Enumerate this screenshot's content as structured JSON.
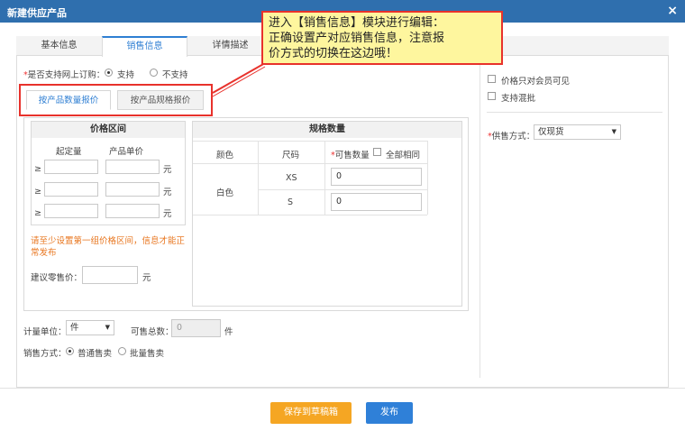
{
  "dialog": {
    "title": "新建供应产品",
    "close_glyph": "×"
  },
  "tabs": [
    {
      "label": "基本信息"
    },
    {
      "label": "销售信息"
    },
    {
      "label": "详情描述"
    }
  ],
  "online_order": {
    "label": "是否支持网上订购：",
    "required_mark": "*",
    "options": [
      {
        "label": "支持",
        "selected": true
      },
      {
        "label": "不支持",
        "selected": false
      }
    ]
  },
  "price_tabs": [
    {
      "label": "按产品数量报价"
    },
    {
      "label": "按产品规格报价"
    }
  ],
  "price_range": {
    "header": "价格区间",
    "col_min": "起定量",
    "col_price": "产品单价",
    "ge": "≥",
    "unit": "元",
    "rows": [
      {
        "min": "",
        "price": ""
      },
      {
        "min": "",
        "price": ""
      },
      {
        "min": "",
        "price": ""
      }
    ],
    "warning": "请至少设置第一组价格区间，信息才能正常发布",
    "suggest_label": "建议零售价：",
    "suggest_value": "",
    "suggest_unit": "元"
  },
  "spec": {
    "header": "规格数量",
    "col_color": "颜色",
    "col_size": "尺码",
    "col_qty": "可售数量",
    "required_mark": "*",
    "all_same": "全部相同",
    "color": "白色",
    "rows": [
      {
        "size": "XS",
        "qty": "0"
      },
      {
        "size": "S",
        "qty": "0"
      }
    ]
  },
  "unit": {
    "label": "计量单位：",
    "value": "件"
  },
  "total": {
    "label": "可售总数：",
    "value": "0",
    "unit": "件"
  },
  "sale_mode": {
    "label": "销售方式：",
    "options": [
      {
        "label": "普通售卖",
        "selected": true
      },
      {
        "label": "批量售卖",
        "selected": false
      }
    ]
  },
  "right_panel": {
    "member_only": "价格只对会员可见",
    "mixed_batch": "支持混批",
    "supply_label": "供售方式：",
    "required_mark": "*",
    "supply_value": "仅现货"
  },
  "buttons": {
    "draft": "保存到草稿箱",
    "publish": "发布"
  },
  "tooltip": {
    "line1": "进入【销售信息】模块进行编辑：",
    "line2": "正确设置产对应销售信息，注意报",
    "line3": "价方式的切换在这边哦！"
  },
  "colors": {
    "titlebar": "#2f6fae",
    "accent": "#2f7fd3",
    "draft_button": "#f5a623",
    "publish_button": "#2f80d8",
    "warning": "#e8761f",
    "highlight": "#e8322c"
  }
}
